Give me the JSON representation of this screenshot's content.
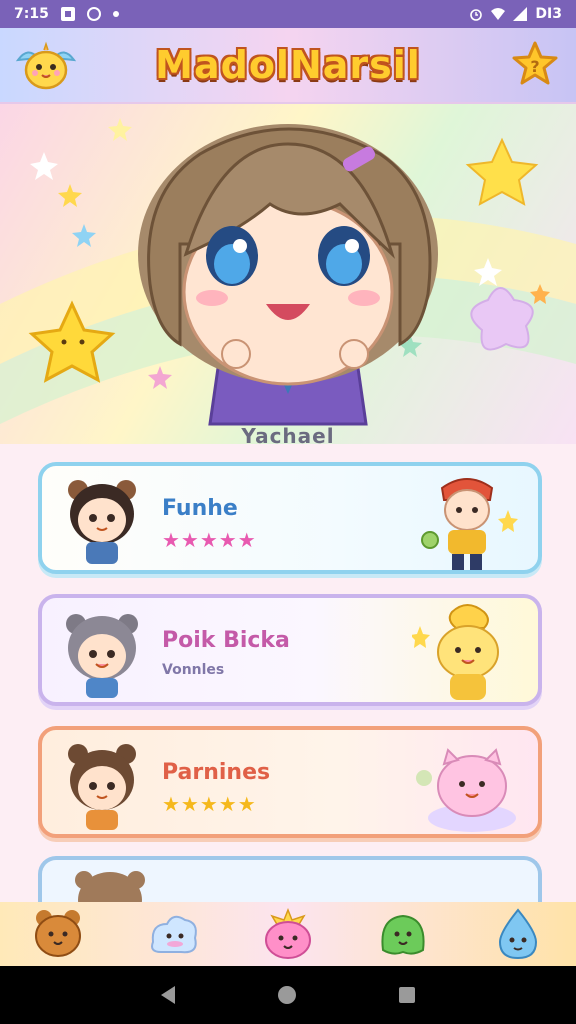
{
  "status_bar": {
    "time": "7:15",
    "battery_label": "DI3"
  },
  "header": {
    "title": "MadolNarsil",
    "mascot_icon": "chick-mascot-icon",
    "help_icon": "star-help-icon"
  },
  "hero": {
    "character_name": "Yachael"
  },
  "cards": [
    {
      "title": "Funhe",
      "rating": 5,
      "stars": "★★★★★",
      "subtitle": ""
    },
    {
      "title": "Poik Bicka",
      "rating": 0,
      "stars": "",
      "subtitle": "Vonnles"
    },
    {
      "title": "Parnines",
      "rating": 5,
      "stars": "★★★★★",
      "subtitle": ""
    }
  ],
  "colors": {
    "status_bar": "#7a62b8",
    "title_fill": "#ffcc2e",
    "title_outline": "#c0541f"
  },
  "bottom_nav": [
    {
      "icon": "bear-icon"
    },
    {
      "icon": "cloud-spirit-icon"
    },
    {
      "icon": "pink-star-blob-icon"
    },
    {
      "icon": "green-blob-icon"
    },
    {
      "icon": "blue-droplet-icon"
    }
  ]
}
